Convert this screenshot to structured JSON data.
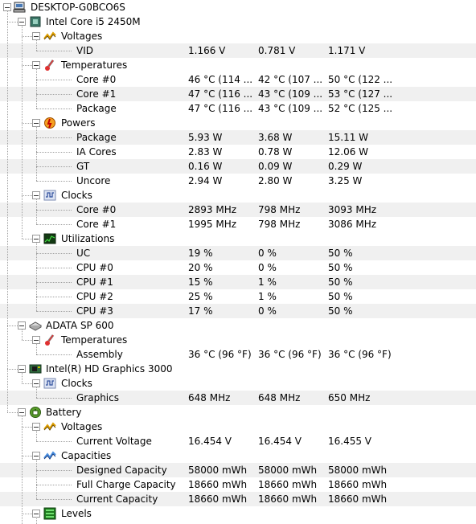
{
  "columns": [
    "c1",
    "c2",
    "c3"
  ],
  "rows": [
    {
      "level": 0,
      "type": "node",
      "label": "DESKTOP-G0BCO6S",
      "icon": "computer-icon"
    },
    {
      "level": 1,
      "type": "node",
      "label": "Intel Core i5 2450M",
      "icon": "cpu-chip-icon"
    },
    {
      "level": 2,
      "type": "node",
      "label": "Voltages",
      "icon": "voltage-icon"
    },
    {
      "level": 3,
      "type": "leaf",
      "label": "VID",
      "values": [
        "1.166 V",
        "0.781 V",
        "1.171 V"
      ]
    },
    {
      "level": 2,
      "type": "node",
      "label": "Temperatures",
      "icon": "thermometer-icon"
    },
    {
      "level": 3,
      "type": "leaf",
      "label": "Core #0",
      "values": [
        "46 °C  (114 ...",
        "42 °C  (107 ...",
        "50 °C  (122 ..."
      ]
    },
    {
      "level": 3,
      "type": "leaf",
      "label": "Core #1",
      "values": [
        "47 °C  (116 ...",
        "43 °C  (109 ...",
        "53 °C  (127 ..."
      ]
    },
    {
      "level": 3,
      "type": "leaf",
      "label": "Package",
      "values": [
        "47 °C  (116 ...",
        "43 °C  (109 ...",
        "52 °C  (125 ..."
      ]
    },
    {
      "level": 2,
      "type": "node",
      "label": "Powers",
      "icon": "power-icon"
    },
    {
      "level": 3,
      "type": "leaf",
      "label": "Package",
      "values": [
        "5.93 W",
        "3.68 W",
        "15.11 W"
      ]
    },
    {
      "level": 3,
      "type": "leaf",
      "label": "IA Cores",
      "values": [
        "2.83 W",
        "0.78 W",
        "12.06 W"
      ]
    },
    {
      "level": 3,
      "type": "leaf",
      "label": "GT",
      "values": [
        "0.16 W",
        "0.09 W",
        "0.29 W"
      ]
    },
    {
      "level": 3,
      "type": "leaf",
      "label": "Uncore",
      "values": [
        "2.94 W",
        "2.80 W",
        "3.25 W"
      ]
    },
    {
      "level": 2,
      "type": "node",
      "label": "Clocks",
      "icon": "clock-wave-icon"
    },
    {
      "level": 3,
      "type": "leaf",
      "label": "Core #0",
      "values": [
        "2893 MHz",
        "798 MHz",
        "3093 MHz"
      ]
    },
    {
      "level": 3,
      "type": "leaf",
      "label": "Core #1",
      "values": [
        "1995 MHz",
        "798 MHz",
        "3086 MHz"
      ]
    },
    {
      "level": 2,
      "type": "node",
      "label": "Utilizations",
      "icon": "utilization-icon"
    },
    {
      "level": 3,
      "type": "leaf",
      "label": "UC",
      "values": [
        "19 %",
        "0 %",
        "50 %"
      ]
    },
    {
      "level": 3,
      "type": "leaf",
      "label": "CPU #0",
      "values": [
        "20 %",
        "0 %",
        "50 %"
      ]
    },
    {
      "level": 3,
      "type": "leaf",
      "label": "CPU #1",
      "values": [
        "15 %",
        "1 %",
        "50 %"
      ]
    },
    {
      "level": 3,
      "type": "leaf",
      "label": "CPU #2",
      "values": [
        "25 %",
        "1 %",
        "50 %"
      ]
    },
    {
      "level": 3,
      "type": "leaf",
      "label": "CPU #3",
      "values": [
        "17 %",
        "0 %",
        "50 %"
      ]
    },
    {
      "level": 1,
      "type": "node",
      "label": "ADATA SP 600",
      "icon": "disk-icon"
    },
    {
      "level": 2,
      "type": "node",
      "label": "Temperatures",
      "icon": "thermometer-icon"
    },
    {
      "level": 3,
      "type": "leaf",
      "label": "Assembly",
      "values": [
        "36 °C  (96 °F)",
        "36 °C  (96 °F)",
        "36 °C  (96 °F)"
      ]
    },
    {
      "level": 1,
      "type": "node",
      "label": "Intel(R) HD Graphics 3000",
      "icon": "gpu-icon"
    },
    {
      "level": 2,
      "type": "node",
      "label": "Clocks",
      "icon": "clock-wave-icon"
    },
    {
      "level": 3,
      "type": "leaf",
      "label": "Graphics",
      "values": [
        "648 MHz",
        "648 MHz",
        "650 MHz"
      ]
    },
    {
      "level": 1,
      "type": "node",
      "label": "Battery",
      "icon": "battery-icon"
    },
    {
      "level": 2,
      "type": "node",
      "label": "Voltages",
      "icon": "voltage-icon"
    },
    {
      "level": 3,
      "type": "leaf",
      "label": "Current Voltage",
      "values": [
        "16.454 V",
        "16.454 V",
        "16.455 V"
      ]
    },
    {
      "level": 2,
      "type": "node",
      "label": "Capacities",
      "icon": "capacity-icon"
    },
    {
      "level": 3,
      "type": "leaf",
      "label": "Designed Capacity",
      "values": [
        "58000 mWh",
        "58000 mWh",
        "58000 mWh"
      ]
    },
    {
      "level": 3,
      "type": "leaf",
      "label": "Full Charge Capacity",
      "values": [
        "18660 mWh",
        "18660 mWh",
        "18660 mWh"
      ]
    },
    {
      "level": 3,
      "type": "leaf",
      "label": "Current Capacity",
      "values": [
        "18660 mWh",
        "18660 mWh",
        "18660 mWh"
      ]
    },
    {
      "level": 2,
      "type": "node",
      "label": "Levels",
      "icon": "levels-icon"
    }
  ]
}
